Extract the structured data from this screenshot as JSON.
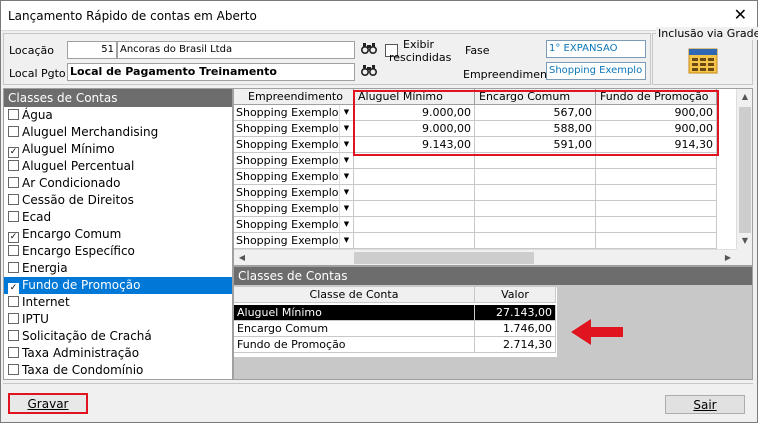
{
  "window": {
    "title": "Lançamento Rápido de contas em Aberto",
    "close_glyph": "✕"
  },
  "form": {
    "localizacao_label": "Locação",
    "localizacao_code": "51",
    "localizacao_name": "Ancoras do Brasil Ltda",
    "local_pgto_label": "Local Pgto",
    "local_pgto_value": "Local de Pagamento Treinamento",
    "exibir_label_1": "Exibir",
    "exibir_label_2": "rescindidas",
    "fase_label": "Fase",
    "fase_value": "1° EXPANSAO",
    "empreendimento_label": "Empreendimento",
    "empreendimento_value": "Shopping Exemplo",
    "inclusao_label": "Inclusão via Grade"
  },
  "classes_panel": {
    "header": "Classes de Contas",
    "items": [
      {
        "label": "Água",
        "checked": false,
        "selected": false
      },
      {
        "label": "Aluguel Merchandising",
        "checked": false,
        "selected": false
      },
      {
        "label": "Aluguel Mínimo",
        "checked": true,
        "selected": false
      },
      {
        "label": "Aluguel Percentual",
        "checked": false,
        "selected": false
      },
      {
        "label": "Ar Condicionado",
        "checked": false,
        "selected": false
      },
      {
        "label": "Cessão de Direitos",
        "checked": false,
        "selected": false
      },
      {
        "label": "Ecad",
        "checked": false,
        "selected": false
      },
      {
        "label": "Encargo Comum",
        "checked": true,
        "selected": false
      },
      {
        "label": "Encargo Específico",
        "checked": false,
        "selected": false
      },
      {
        "label": "Energia",
        "checked": false,
        "selected": false
      },
      {
        "label": "Fundo de Promoção",
        "checked": true,
        "selected": true
      },
      {
        "label": "Internet",
        "checked": false,
        "selected": false
      },
      {
        "label": "IPTU",
        "checked": false,
        "selected": false
      },
      {
        "label": "Solicitação de Crachá",
        "checked": false,
        "selected": false
      },
      {
        "label": "Taxa Administração",
        "checked": false,
        "selected": false
      },
      {
        "label": "Taxa de Condomínio",
        "checked": false,
        "selected": false
      }
    ]
  },
  "grid": {
    "columns": [
      "Empreendimento",
      "Aluguel Mínimo",
      "Encargo Comum",
      "Fundo de Promoção"
    ],
    "rows": [
      [
        "Shopping Exemplo",
        "9.000,00",
        "567,00",
        "900,00"
      ],
      [
        "Shopping Exemplo",
        "9.000,00",
        "588,00",
        "900,00"
      ],
      [
        "Shopping Exemplo",
        "9.143,00",
        "591,00",
        "914,30"
      ],
      [
        "Shopping Exemplo",
        "",
        "",
        ""
      ],
      [
        "Shopping Exemplo",
        "",
        "",
        ""
      ],
      [
        "Shopping Exemplo",
        "",
        "",
        ""
      ],
      [
        "Shopping Exemplo",
        "",
        "",
        ""
      ],
      [
        "Shopping Exemplo",
        "",
        "",
        ""
      ],
      [
        "Shopping Exemplo",
        "",
        "",
        ""
      ]
    ],
    "highlight_color": "#e0141e"
  },
  "summary": {
    "header": "Classes de Contas",
    "columns": [
      "Classe de Conta",
      "Valor"
    ],
    "rows": [
      [
        "Aluguel Mínimo",
        "27.143,00"
      ],
      [
        "Encargo Comum",
        "1.746,00"
      ],
      [
        "Fundo de Promoção",
        "2.714,30"
      ]
    ]
  },
  "buttons": {
    "gravar": "Gravar",
    "sair": "Sair"
  }
}
